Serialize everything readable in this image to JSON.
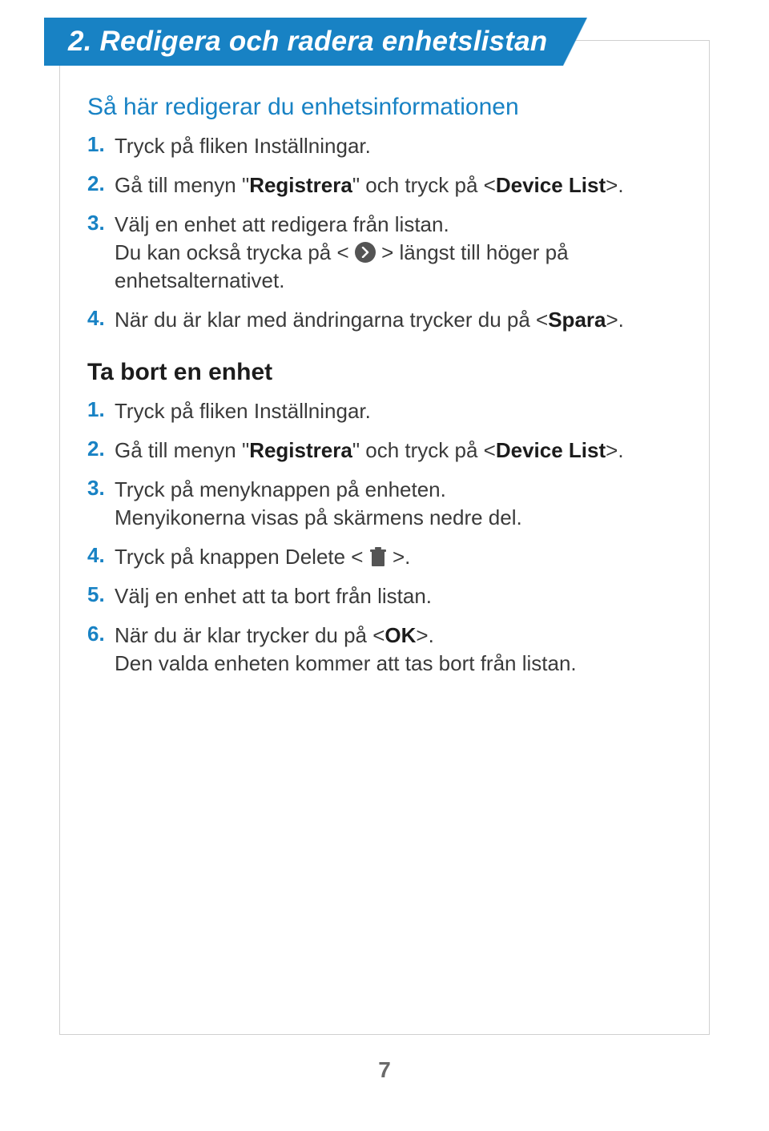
{
  "title": "2. Redigera och radera enhetslistan",
  "section1": {
    "heading": "Så här redigerar du enhetsinformationen",
    "steps": [
      {
        "num": "1.",
        "parts": [
          {
            "t": "Tryck på fliken Inställningar."
          }
        ]
      },
      {
        "num": "2.",
        "parts": [
          {
            "t": "Gå till menyn \""
          },
          {
            "t": "Registrera",
            "bold": true
          },
          {
            "t": "\" och tryck på <"
          },
          {
            "t": "Device List",
            "bold": true
          },
          {
            "t": ">."
          }
        ]
      },
      {
        "num": "3.",
        "parts": [
          {
            "t": "Välj en enhet att redigera från listan."
          },
          {
            "br": true
          },
          {
            "t": "Du kan också trycka på < "
          },
          {
            "icon": "chevron"
          },
          {
            "t": " > längst till höger på enhetsalternativet."
          }
        ]
      },
      {
        "num": "4.",
        "parts": [
          {
            "t": "När du är klar med ändringarna trycker du på <"
          },
          {
            "t": "Spara",
            "bold": true
          },
          {
            "t": ">."
          }
        ]
      }
    ]
  },
  "section2": {
    "heading": "Ta bort en enhet",
    "steps": [
      {
        "num": "1.",
        "parts": [
          {
            "t": "Tryck på fliken Inställningar."
          }
        ]
      },
      {
        "num": "2.",
        "parts": [
          {
            "t": "Gå till menyn \""
          },
          {
            "t": "Registrera",
            "bold": true
          },
          {
            "t": "\" och tryck på <"
          },
          {
            "t": "Device List",
            "bold": true
          },
          {
            "t": ">."
          }
        ]
      },
      {
        "num": "3.",
        "parts": [
          {
            "t": "Tryck på menyknappen på enheten."
          },
          {
            "br": true
          },
          {
            "t": "Menyikonerna visas på skärmens nedre del."
          }
        ]
      },
      {
        "num": "4.",
        "parts": [
          {
            "t": "Tryck på knappen Delete < "
          },
          {
            "icon": "trash"
          },
          {
            "t": " >."
          }
        ]
      },
      {
        "num": "5.",
        "parts": [
          {
            "t": "Välj en enhet att ta bort från listan."
          }
        ]
      },
      {
        "num": "6.",
        "parts": [
          {
            "t": "När du är klar trycker du på <"
          },
          {
            "t": "OK",
            "bold": true
          },
          {
            "t": ">."
          },
          {
            "br": true
          },
          {
            "t": "Den valda enheten kommer att tas bort från listan."
          }
        ]
      }
    ]
  },
  "pageNumber": "7"
}
